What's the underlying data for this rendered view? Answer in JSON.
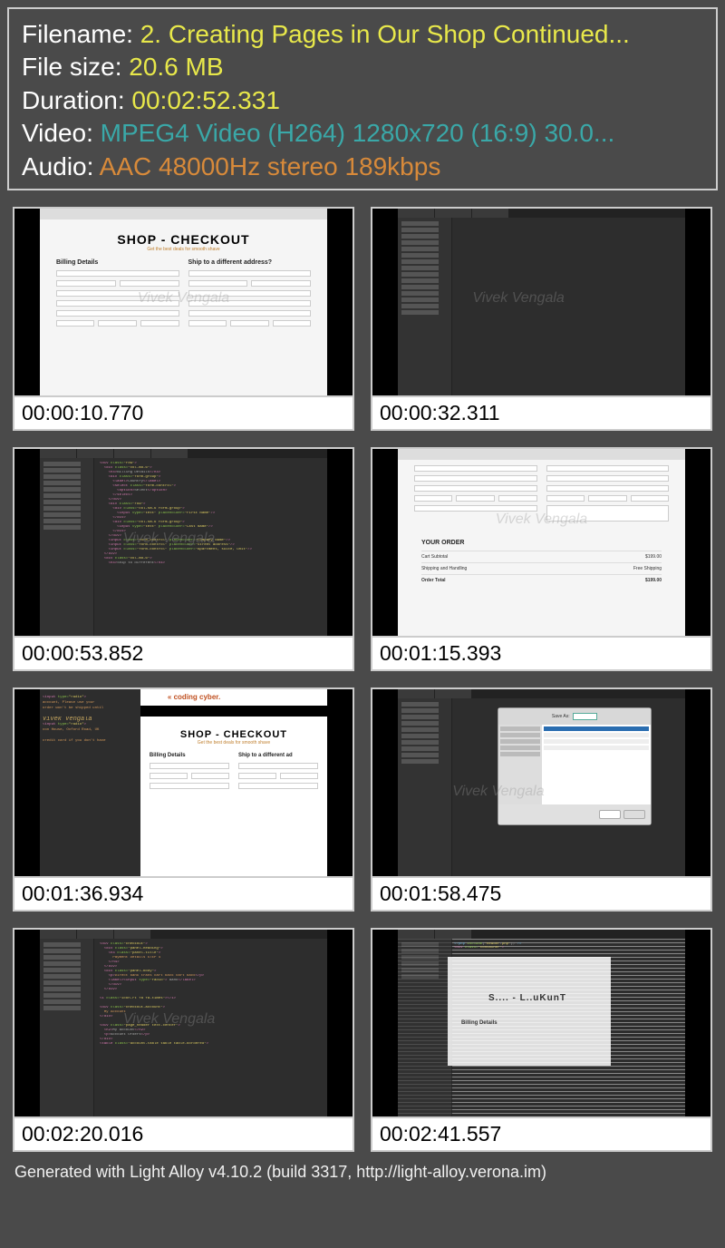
{
  "info": {
    "filename_label": "Filename: ",
    "filename_value": "2. Creating Pages in Our Shop Continued...",
    "filesize_label": "File size: ",
    "filesize_value": "20.6 MB",
    "duration_label": "Duration: ",
    "duration_value": "00:02:52.331",
    "video_label": "Video: ",
    "video_value": "MPEG4 Video (H264) 1280x720 (16:9) 30.0...",
    "audio_label": "Audio: ",
    "audio_value": "AAC 48000Hz stereo 189kbps"
  },
  "thumbs": [
    {
      "ts": "00:00:10.770",
      "kind": "checkout-light"
    },
    {
      "ts": "00:00:32.311",
      "kind": "ide-empty"
    },
    {
      "ts": "00:00:53.852",
      "kind": "ide-code"
    },
    {
      "ts": "00:01:15.393",
      "kind": "form-order"
    },
    {
      "ts": "00:01:36.934",
      "kind": "split-checkout"
    },
    {
      "ts": "00:01:58.475",
      "kind": "ide-dialog"
    },
    {
      "ts": "00:02:20.016",
      "kind": "ide-code2"
    },
    {
      "ts": "00:02:41.557",
      "kind": "glitch"
    }
  ],
  "checkout": {
    "title": "SHOP - CHECKOUT",
    "subtitle": "Get the best deals for smooth shave",
    "billing": "Billing Details",
    "ship": "Ship to a different address?",
    "watermark": "Vivek Vengala",
    "logo": "« coding cyber.",
    "order_head": "YOUR ORDER",
    "rows": [
      [
        "Cart Subtotal",
        "$199.00"
      ],
      [
        "Shipping and Handling",
        "Free Shipping"
      ],
      [
        "Order Total",
        "$199.00"
      ]
    ]
  },
  "footer": "Generated with Light Alloy v4.10.2 (build 3317, http://light-alloy.verona.im)"
}
